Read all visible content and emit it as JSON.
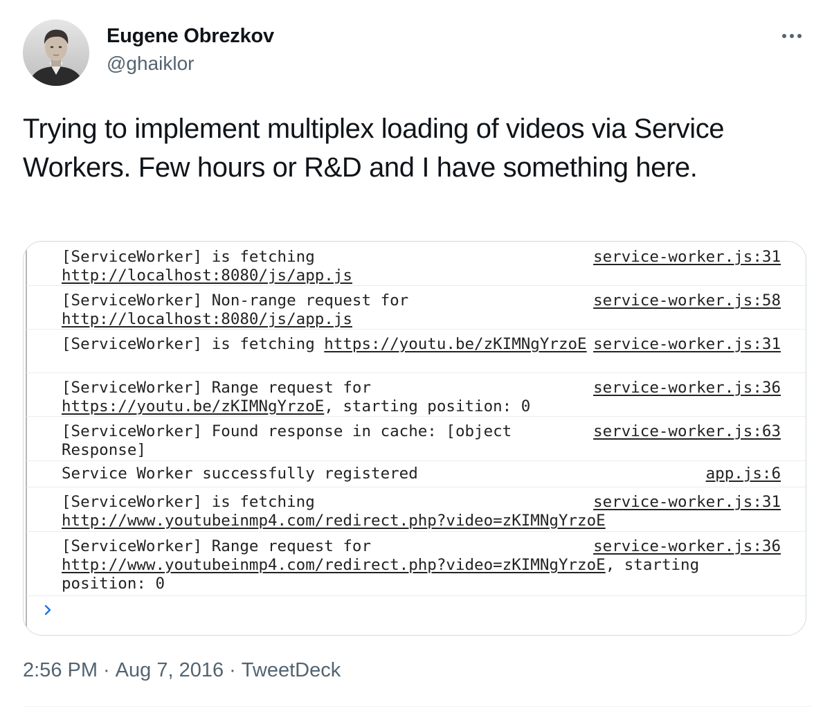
{
  "author": {
    "name": "Eugene Obrezkov",
    "handle": "@ghaiklor"
  },
  "tweet": {
    "text": "Trying to implement multiplex loading of videos via Service Workers. Few hours or R&D and I have something here.",
    "time": "2:56 PM",
    "date": "Aug 7, 2016",
    "separator": "·",
    "via": "TweetDeck"
  },
  "console": {
    "prompt_icon": "chevron-right-icon",
    "rows": [
      {
        "prefix": "[ServiceWorker] is fetching ",
        "link": "http://localhost:8080/js/app.js",
        "suffix": "",
        "source": "service-worker.js:31"
      },
      {
        "prefix": "[ServiceWorker] Non-range request for ",
        "link": "http://localhost:8080/js/app.js",
        "suffix": "",
        "source": "service-worker.js:58"
      },
      {
        "prefix": "[ServiceWorker] is fetching ",
        "link": "https://youtu.be/zKIMNgYrzoE",
        "suffix": "",
        "source": "service-worker.js:31"
      },
      {
        "prefix": "[ServiceWorker] Range request for ",
        "link": "https://youtu.be/zKIMNgYrzoE",
        "suffix": ", starting position: 0",
        "source": "service-worker.js:36"
      },
      {
        "prefix": "[ServiceWorker] Found response in cache: [object Response]",
        "link": "",
        "suffix": "",
        "source": "service-worker.js:63"
      },
      {
        "prefix": "Service Worker successfully registered",
        "link": "",
        "suffix": "",
        "source": "app.js:6"
      },
      {
        "prefix": "[ServiceWorker] is fetching ",
        "link": "http://www.youtubeinmp4.com/redirect.php?video=zKIMNgYrzoE",
        "suffix": "",
        "source": "service-worker.js:31"
      },
      {
        "prefix": "[ServiceWorker] Range request for ",
        "link": "http://www.youtubeinmp4.com/redirect.php?video=zKIMNgYrzoE",
        "suffix": ", starting position: 0",
        "source": "service-worker.js:36"
      }
    ]
  },
  "colors": {
    "text_primary": "#0f1419",
    "text_secondary": "#536471",
    "border": "#cfd9de",
    "console_prompt": "#1a73e8"
  }
}
